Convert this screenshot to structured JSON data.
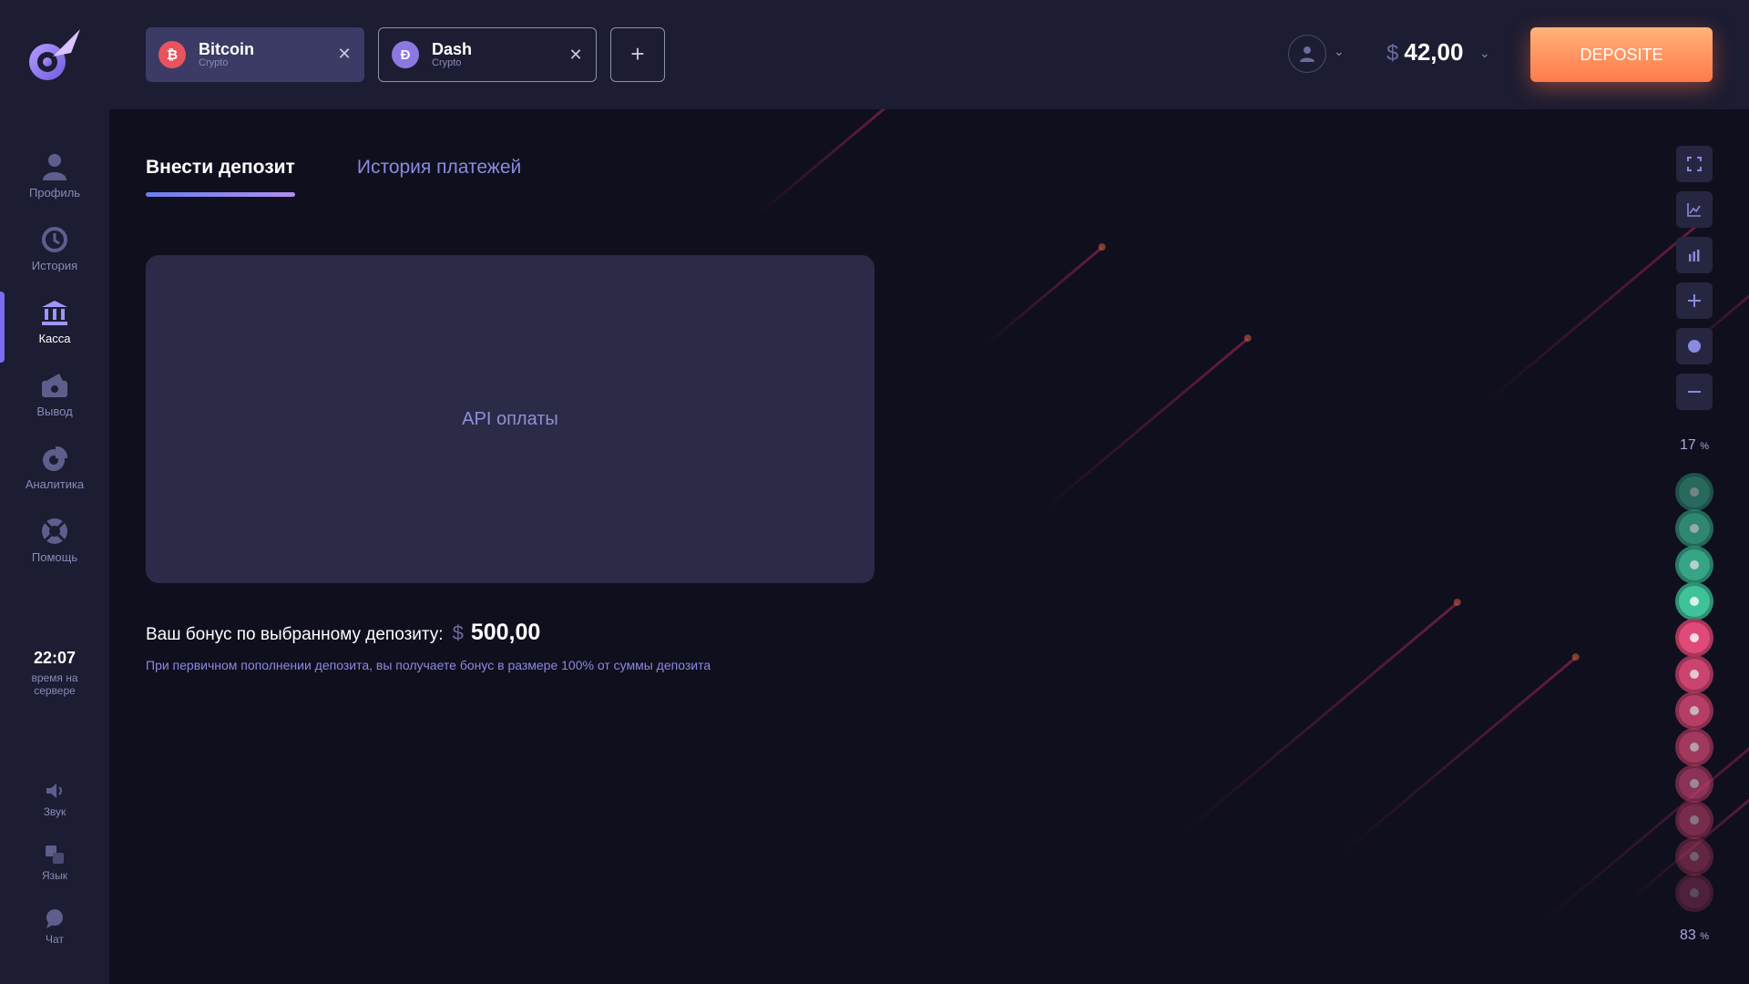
{
  "header": {
    "asset_tabs": [
      {
        "name": "Bitcoin",
        "sub": "Crypto",
        "symbol": "₿"
      },
      {
        "name": "Dash",
        "sub": "Crypto",
        "symbol": "Đ"
      }
    ],
    "add_tab_label": "+",
    "balance_currency": "$",
    "balance_amount": "42,00",
    "deposit_label": "DEPOSITE"
  },
  "sidebar": {
    "items": [
      {
        "label": "Профиль",
        "icon": "user-icon"
      },
      {
        "label": "История",
        "icon": "history-icon"
      },
      {
        "label": "Касса",
        "icon": "bank-icon"
      },
      {
        "label": "Вывод",
        "icon": "wallet-icon"
      },
      {
        "label": "Аналитика",
        "icon": "analytics-icon"
      },
      {
        "label": "Помощь",
        "icon": "lifebuoy-icon"
      }
    ],
    "active_index": 2,
    "server_time": "22:07",
    "server_time_label_1": "время на",
    "server_time_label_2": "сервере",
    "bottom": [
      {
        "label": "Звук",
        "icon": "sound-icon"
      },
      {
        "label": "Язык",
        "icon": "language-icon"
      },
      {
        "label": "Чат",
        "icon": "chat-icon"
      }
    ]
  },
  "main": {
    "tabs": [
      "Внести депозит",
      "История платежей"
    ],
    "active_tab": 0,
    "api_placeholder": "API оплаты",
    "bonus_label": "Ваш бонус по выбранному депозиту:",
    "bonus_currency": "$",
    "bonus_amount": "500,00",
    "bonus_note": "При первичном пополнении депозита, вы получаете бонус в размере 100% от суммы депозита"
  },
  "right_panel": {
    "tools": [
      "fullscreen-icon",
      "line-chart-icon",
      "bar-chart-icon",
      "plus-icon",
      "dot-icon",
      "minus-icon"
    ],
    "top_percent": "17",
    "bottom_percent": "83",
    "percent_sign": "%",
    "sentiment_dots": [
      {
        "type": "up"
      },
      {
        "type": "up"
      },
      {
        "type": "up"
      },
      {
        "type": "up"
      },
      {
        "type": "down"
      },
      {
        "type": "down"
      },
      {
        "type": "down"
      },
      {
        "type": "down"
      },
      {
        "type": "down"
      },
      {
        "type": "down"
      },
      {
        "type": "down"
      },
      {
        "type": "down"
      }
    ]
  },
  "colors": {
    "accent_orange": "#ff8a55",
    "accent_purple": "#7b6cf0",
    "up_green": "#3fc19a",
    "down_pink": "#e04a78"
  }
}
